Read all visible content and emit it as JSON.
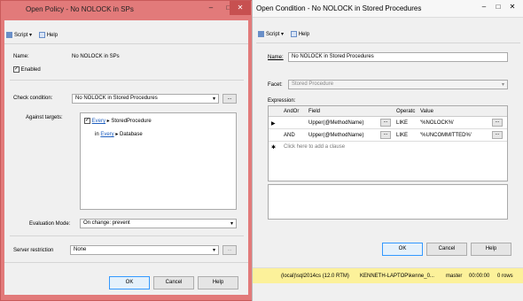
{
  "left_window": {
    "title": "Open Policy - No NOLOCK in SPs",
    "toolbar": {
      "script_label": "Script",
      "help_label": "Help"
    },
    "name_label": "Name:",
    "name_value": "No NOLOCK in SPs",
    "enabled_label": "Enabled",
    "check_condition_label": "Check condition:",
    "check_condition_value": "No NOLOCK in Stored Procedures",
    "ellipsis": "...",
    "against_targets_label": "Against targets:",
    "target_every_1": "Every",
    "target_obj_1": "StoredProcedure",
    "target_in": "in",
    "target_every_2": "Every",
    "target_obj_2": "Database",
    "evaluation_mode_label": "Evaluation Mode:",
    "evaluation_mode_value": "On change: prevent",
    "server_restriction_label": "Server restriction",
    "server_restriction_value": "None",
    "ok_label": "OK",
    "cancel_label": "Cancel",
    "help_button_label": "Help"
  },
  "right_window": {
    "title": "Open Condition - No NOLOCK in Stored Procedures",
    "toolbar": {
      "script_label": "Script",
      "help_label": "Help"
    },
    "name_label": "Name:",
    "name_value": "No NOLOCK in Stored Procedures",
    "facet_label": "Facet:",
    "facet_value": "Stored Procedure",
    "expression_label": "Expression:",
    "grid": {
      "headers": [
        "AndOr",
        "Field",
        "Operatc",
        "Value"
      ],
      "rows": [
        {
          "andor": "",
          "field": "Upper(@MethodName)",
          "op": "LIKE",
          "value": "'%NOLOCK%'"
        },
        {
          "andor": "AND",
          "field": "Upper(@MethodName)",
          "op": "LIKE",
          "value": "'%UNCOMMITTED%'"
        }
      ],
      "add_clause": "Click here to add a clause"
    },
    "ok_label": "OK",
    "cancel_label": "Cancel",
    "help_button_label": "Help"
  },
  "status_bar": {
    "server": "(local)\\sql2014cs (12.0 RTM)",
    "user": "KENNETH-LAPTOP\\kenne_0...",
    "db": "master",
    "time": "00:00:00",
    "rows": "0 rows"
  }
}
